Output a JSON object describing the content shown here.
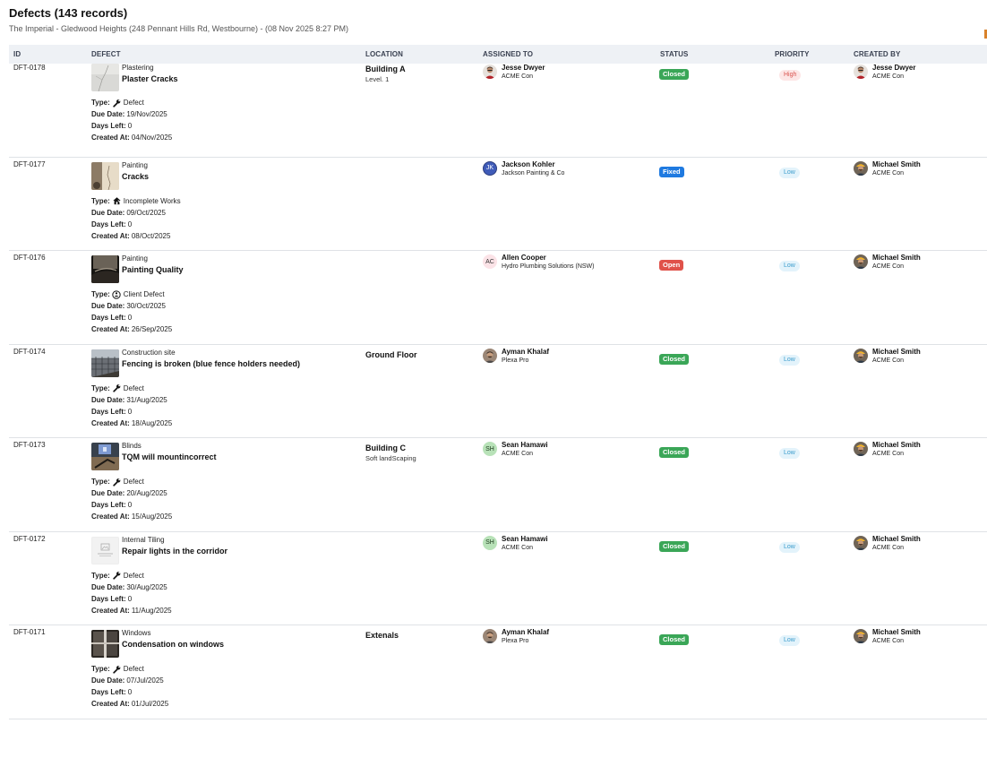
{
  "header": {
    "title": "Defects (143 records)",
    "subtitle": "The Imperial - Gledwood Heights (248 Pennant Hills Rd, Westbourne) - (08 Nov 2025 8:27 PM)"
  },
  "columns": {
    "id": "ID",
    "defect": "DEFECT",
    "location": "LOCATION",
    "assigned": "ASSIGNED TO",
    "status": "STATUS",
    "priority": "PRIORITY",
    "created_by": "CREATED BY"
  },
  "labels": {
    "type": "Type:",
    "due_date": "Due Date:",
    "days_left": "Days Left:",
    "created_at": "Created At:"
  },
  "colors": {
    "closed": "#3aa657",
    "fixed": "#1f7ae0",
    "open": "#e0524a",
    "high_bg": "#fde6e6",
    "high_fg": "#d9534f",
    "low_bg": "#e3f3fb",
    "low_fg": "#3b9ccc"
  },
  "rows": [
    {
      "id": "DFT-0178",
      "thumb": "plaster",
      "category": "Plastering",
      "title": "Plaster Cracks",
      "type_icon": "wrench-icon",
      "type": "Defect",
      "due_date": "19/Nov/2025",
      "days_left": "0",
      "created_at": "04/Nov/2025",
      "location": "Building A",
      "sublocation": "Level. 1",
      "assigned_name": "Jesse Dwyer",
      "assigned_org": "ACME Con",
      "assigned_avatar": "photo-a",
      "assigned_initials": "",
      "status": "Closed",
      "status_color": "#3aa657",
      "priority": "High",
      "priority_bg": "#fde6e6",
      "priority_fg": "#d9534f",
      "created_name": "Jesse Dwyer",
      "created_org": "ACME Con",
      "created_avatar": "photo-a"
    },
    {
      "id": "DFT-0177",
      "thumb": "wall",
      "category": "Painting",
      "title": "Cracks",
      "type_icon": "house-icon",
      "type": "Incomplete Works",
      "due_date": "09/Oct/2025",
      "days_left": "0",
      "created_at": "08/Oct/2025",
      "location": "",
      "sublocation": "",
      "assigned_name": "Jackson Kohler",
      "assigned_org": "Jackson Painting & Co",
      "assigned_avatar": "initials-blue",
      "assigned_initials": "JK",
      "status": "Fixed",
      "status_color": "#1f7ae0",
      "priority": "Low",
      "priority_bg": "#e3f3fb",
      "priority_fg": "#3b9ccc",
      "created_name": "Michael Smith",
      "created_org": "ACME Con",
      "created_avatar": "photo-b"
    },
    {
      "id": "DFT-0176",
      "thumb": "dark",
      "category": "Painting",
      "title": "Painting Quality",
      "type_icon": "client-icon",
      "type": "Client Defect",
      "due_date": "30/Oct/2025",
      "days_left": "0",
      "created_at": "26/Sep/2025",
      "location": "",
      "sublocation": "",
      "assigned_name": "Allen Cooper",
      "assigned_org": "Hydro Plumbing Solutions (NSW)",
      "assigned_avatar": "initials-pink",
      "assigned_initials": "AC",
      "status": "Open",
      "status_color": "#e0524a",
      "priority": "Low",
      "priority_bg": "#e3f3fb",
      "priority_fg": "#3b9ccc",
      "created_name": "Michael Smith",
      "created_org": "ACME Con",
      "created_avatar": "photo-b"
    },
    {
      "id": "DFT-0174",
      "thumb": "fence",
      "category": "Construction site",
      "title": "Fencing is broken (blue fence holders needed)",
      "type_icon": "wrench-icon",
      "type": "Defect",
      "due_date": "31/Aug/2025",
      "days_left": "0",
      "created_at": "18/Aug/2025",
      "location": "Ground Floor",
      "sublocation": "",
      "assigned_name": "Ayman Khalaf",
      "assigned_org": "Plexa Pro",
      "assigned_avatar": "photo-c",
      "assigned_initials": "",
      "status": "Closed",
      "status_color": "#3aa657",
      "priority": "Low",
      "priority_bg": "#e3f3fb",
      "priority_fg": "#3b9ccc",
      "created_name": "Michael Smith",
      "created_org": "ACME Con",
      "created_avatar": "photo-b"
    },
    {
      "id": "DFT-0173",
      "thumb": "blinds",
      "category": "Blinds",
      "title": "TQM will mountincorrect",
      "type_icon": "wrench-icon",
      "type": "Defect",
      "due_date": "20/Aug/2025",
      "days_left": "0",
      "created_at": "15/Aug/2025",
      "location": "Building C",
      "sublocation": "Soft landScaping",
      "assigned_name": "Sean Hamawi",
      "assigned_org": "ACME Con",
      "assigned_avatar": "initials-green",
      "assigned_initials": "SH",
      "status": "Closed",
      "status_color": "#3aa657",
      "priority": "Low",
      "priority_bg": "#e3f3fb",
      "priority_fg": "#3b9ccc",
      "created_name": "Michael Smith",
      "created_org": "ACME Con",
      "created_avatar": "photo-b"
    },
    {
      "id": "DFT-0172",
      "thumb": "placeholder",
      "category": "Internal Tiling",
      "title": "Repair lights in the corridor",
      "type_icon": "wrench-icon",
      "type": "Defect",
      "due_date": "30/Aug/2025",
      "days_left": "0",
      "created_at": "11/Aug/2025",
      "location": "",
      "sublocation": "",
      "assigned_name": "Sean Hamawi",
      "assigned_org": "ACME Con",
      "assigned_avatar": "initials-green",
      "assigned_initials": "SH",
      "status": "Closed",
      "status_color": "#3aa657",
      "priority": "Low",
      "priority_bg": "#e3f3fb",
      "priority_fg": "#3b9ccc",
      "created_name": "Michael Smith",
      "created_org": "ACME Con",
      "created_avatar": "photo-b"
    },
    {
      "id": "DFT-0171",
      "thumb": "window",
      "category": "Windows",
      "title": "Condensation on windows",
      "type_icon": "wrench-icon",
      "type": "Defect",
      "due_date": "07/Jul/2025",
      "days_left": "0",
      "created_at": "01/Jul/2025",
      "location": "Extenals",
      "sublocation": "",
      "assigned_name": "Ayman Khalaf",
      "assigned_org": "Plexa Pro",
      "assigned_avatar": "photo-c",
      "assigned_initials": "",
      "status": "Closed",
      "status_color": "#3aa657",
      "priority": "Low",
      "priority_bg": "#e3f3fb",
      "priority_fg": "#3b9ccc",
      "created_name": "Michael Smith",
      "created_org": "ACME Con",
      "created_avatar": "photo-b"
    }
  ]
}
